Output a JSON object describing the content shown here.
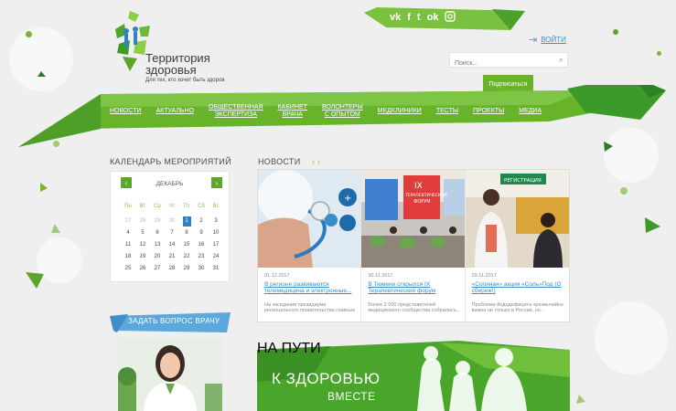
{
  "brand": {
    "name_line1": "Территория",
    "name_line2": "здоровья",
    "tagline": "Для тех, кто хочет быть здоров"
  },
  "social": [
    "vk-icon",
    "facebook-icon",
    "twitter-icon",
    "odnoklassniki-icon",
    "instagram-icon"
  ],
  "header": {
    "login_label": "Войти",
    "search_placeholder": "Поиск...",
    "subscribe_label": "Подписаться"
  },
  "nav": {
    "items": [
      {
        "line1": "Новости",
        "line2": ""
      },
      {
        "line1": "Актуально",
        "line2": ""
      },
      {
        "line1": "Общественная",
        "line2": "экспертиза"
      },
      {
        "line1": "Кабинет",
        "line2": "врача"
      },
      {
        "line1": "Волонтеры",
        "line2": "с опытом"
      },
      {
        "line1": "Медклиники",
        "line2": ""
      },
      {
        "line1": "Тесты",
        "line2": ""
      },
      {
        "line1": "Проекты",
        "line2": ""
      },
      {
        "line1": "Медиа",
        "line2": ""
      }
    ]
  },
  "calendar": {
    "title": "Календарь мероприятий",
    "month": "Декабрь",
    "prev_icon": "chevron-left-icon",
    "next_icon": "chevron-right-icon",
    "weekdays": [
      "Пн",
      "Вт",
      "Ср",
      "Чт",
      "Пт",
      "Сб",
      "Вс"
    ],
    "days": [
      {
        "d": "27",
        "muted": true
      },
      {
        "d": "28",
        "muted": true
      },
      {
        "d": "29",
        "muted": true
      },
      {
        "d": "30",
        "muted": true
      },
      {
        "d": "1",
        "today": true
      },
      {
        "d": "2"
      },
      {
        "d": "3"
      },
      {
        "d": "4"
      },
      {
        "d": "5"
      },
      {
        "d": "6"
      },
      {
        "d": "7"
      },
      {
        "d": "8"
      },
      {
        "d": "9"
      },
      {
        "d": "10"
      },
      {
        "d": "11"
      },
      {
        "d": "12"
      },
      {
        "d": "13"
      },
      {
        "d": "14"
      },
      {
        "d": "15"
      },
      {
        "d": "16"
      },
      {
        "d": "17"
      },
      {
        "d": "18"
      },
      {
        "d": "19"
      },
      {
        "d": "20"
      },
      {
        "d": "21"
      },
      {
        "d": "22"
      },
      {
        "d": "23"
      },
      {
        "d": "24"
      },
      {
        "d": "25"
      },
      {
        "d": "26"
      },
      {
        "d": "27"
      },
      {
        "d": "28"
      },
      {
        "d": "29"
      },
      {
        "d": "30"
      },
      {
        "d": "31"
      }
    ]
  },
  "ask": {
    "label": "Задать вопрос врачу"
  },
  "news": {
    "title": "Новости",
    "cards": [
      {
        "date": "01.12.2017",
        "title": "В регионе развиваются телемедицина и электронные...",
        "desc": "На заседании президиума регионального правительства главные"
      },
      {
        "date": "30.11.2017",
        "title": "В Тюмени открылся IX Терапевтический форум",
        "desc": "Более 2 000 представителей медицинского сообщества собрались..."
      },
      {
        "date": "29.11.2017",
        "title": "«Соляная» акция «Соль»Под (О сбереж!)",
        "desc": "Проблема йододефицита чрезвычайно важна не только в России, но..."
      }
    ],
    "forum_sign_line1": "IX",
    "forum_sign_line2": "ТЕРАПЕВТИЧЕСКИЙ",
    "forum_sign_line3": "ФОРУМ",
    "registration_sign": "РЕГИСТРАЦИЯ"
  },
  "promo": {
    "line1": "НА ПУТИ",
    "line2": "К ЗДОРОВЬЮ",
    "line3": "ВМЕСТЕ"
  },
  "colors": {
    "accent_green": "#69b22a",
    "link_blue": "#3a8dc8",
    "today_blue": "#2f83c5"
  }
}
